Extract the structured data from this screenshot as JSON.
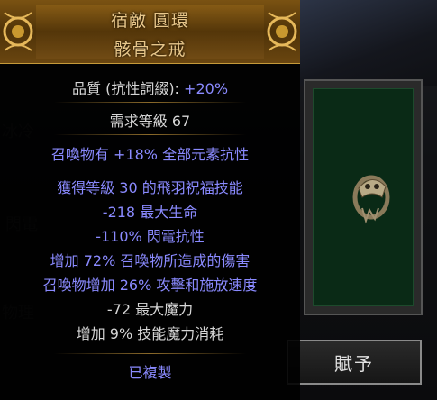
{
  "item": {
    "name_line1": "宿敵 圓環",
    "name_line2": "骸骨之戒",
    "quality_label": "品質 (抗性詞綴):",
    "quality_value": "+20%",
    "req_label": "需求等級",
    "req_value": "67",
    "implicit": "召喚物有 +18% 全部元素抗性",
    "mods": [
      "獲得等級 30 的飛羽祝福技能",
      "-218 最大生命",
      "-110% 閃電抗性",
      "增加 72% 召喚物所造成的傷害",
      "召喚物增加 26% 攻擊和施放速度",
      "-72 最大魔力",
      "增加 9% 技能魔力消耗"
    ],
    "mirrored": "已複製"
  },
  "background": {
    "ghost_texts": [
      "冰冷",
      "閃電",
      "物理"
    ]
  },
  "panel": {
    "give_button": "賦予"
  },
  "colors": {
    "header": "#6a4610",
    "title": "#e7c68a",
    "white": "#d6d6d6",
    "magic_blue": "#8a8aff",
    "art_bg": "#0a2a16"
  },
  "icons": {
    "ornament": "gold-filigree-ornament",
    "item_art": "bone-ring-icon"
  }
}
